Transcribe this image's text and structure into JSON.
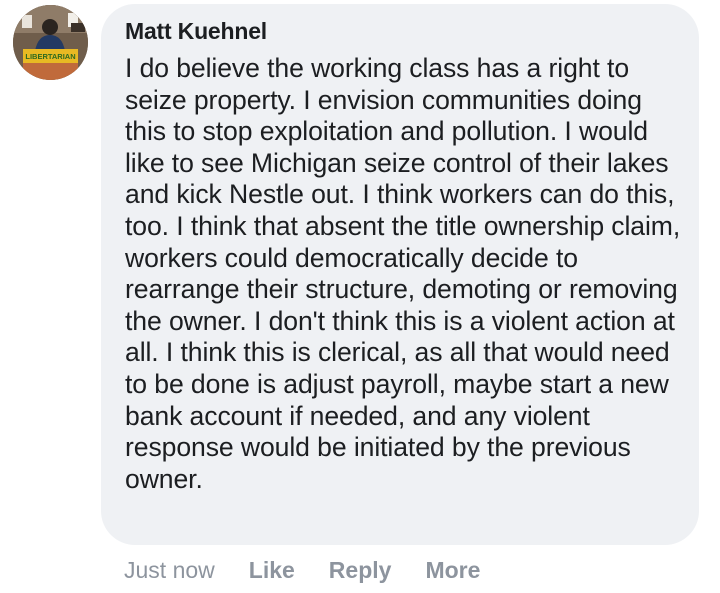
{
  "comment": {
    "author": "Matt Kuehnel",
    "text": "I do believe the working class has a right to seize property. I envision communities doing this to stop exploitation and pollution. I would like to see Michigan seize control of their lakes and kick Nestle out. I think workers can do this, too. I think that absent the title ownership claim, workers could democratically decide to rearrange their structure, demoting or removing the owner. I don't think this is a violent action at all. I think this is clerical, as all that would need to be done is adjust payroll, maybe start a new bank account if needed, and any violent response would be initiated by the previous owner.",
    "avatar_banner_text": "LIBERTARIAN"
  },
  "actions": {
    "timestamp": "Just now",
    "like_label": "Like",
    "reply_label": "Reply",
    "more_label": "More"
  },
  "colors": {
    "bubble_background": "#eff1f4",
    "text": "#1c1e21",
    "secondary_text": "#8d949e",
    "avatar_banner": "#e8b923"
  }
}
